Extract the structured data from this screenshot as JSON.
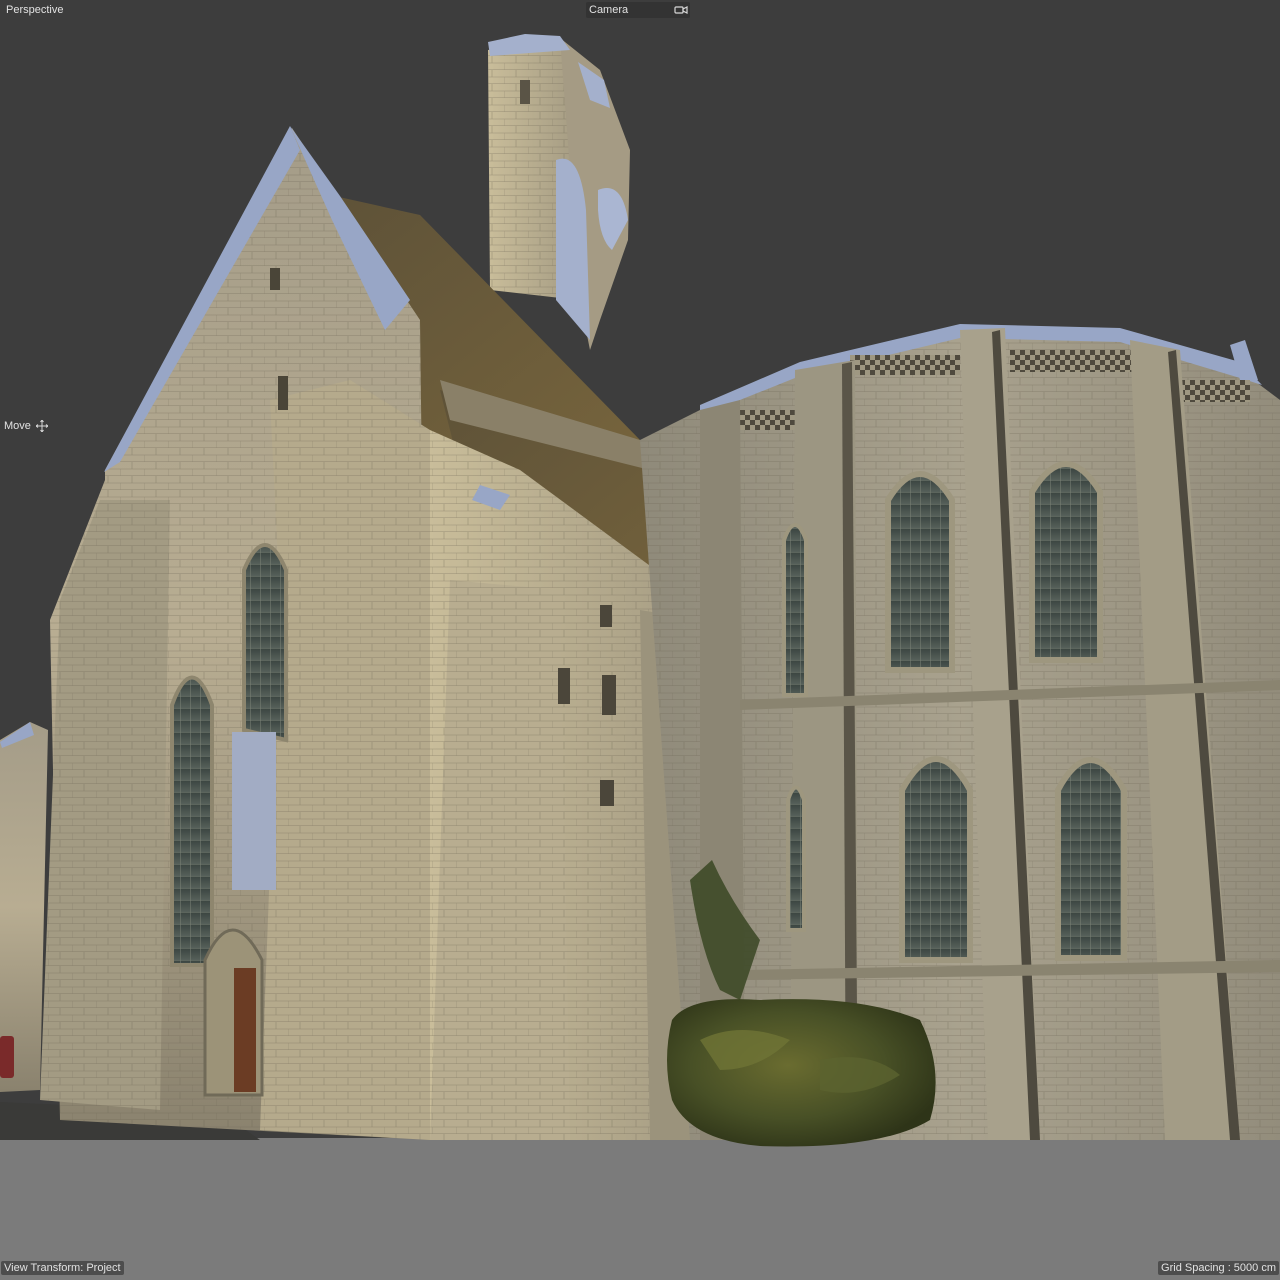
{
  "viewport": {
    "view_mode": "Perspective",
    "camera_menu": "Camera",
    "camera_icon": "camera-icon",
    "tool_name": "Move",
    "tool_icon": "move-arrows-icon",
    "status_view_transform": "View Transform: Project",
    "status_grid_spacing": "Grid Spacing : 5000 cm",
    "colors": {
      "background": "#3d3d3d",
      "ground": "#7b7b7b",
      "stone": "#bcb196",
      "stone_dark": "#6e6858",
      "roof": "#6b5a3a",
      "glass": "#4a5248",
      "mesh_edge": "#98a6c6",
      "moss": "#4a5228"
    }
  }
}
